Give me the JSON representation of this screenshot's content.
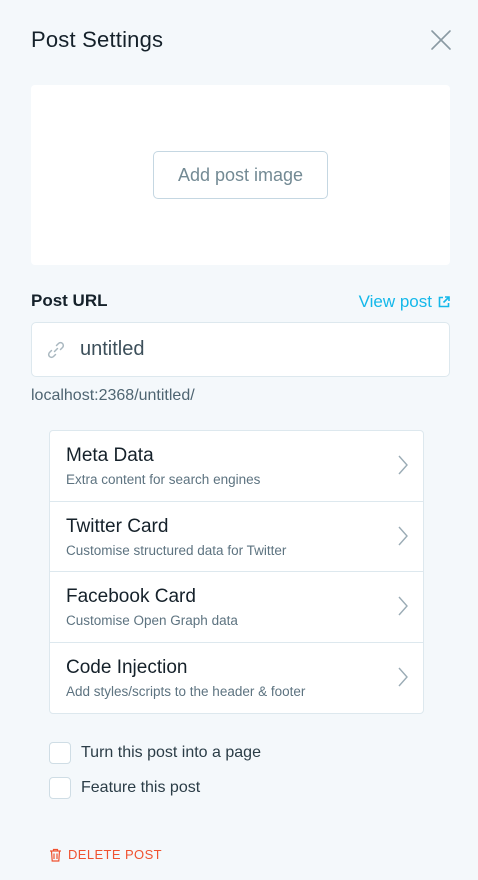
{
  "panel": {
    "title": "Post Settings"
  },
  "image": {
    "add_label": "Add post image"
  },
  "url": {
    "label": "Post URL",
    "view_post_label": "View post",
    "value": "untitled",
    "preview": "localhost:2368/untitled/"
  },
  "menu": {
    "items": [
      {
        "title": "Meta Data",
        "description": "Extra content for search engines"
      },
      {
        "title": "Twitter Card",
        "description": "Customise structured data for Twitter"
      },
      {
        "title": "Facebook Card",
        "description": "Customise Open Graph data"
      },
      {
        "title": "Code Injection",
        "description": "Add styles/scripts to the header & footer"
      }
    ]
  },
  "options": {
    "page_label": "Turn this post into a page",
    "feature_label": "Feature this post"
  },
  "danger": {
    "delete_label": "DELETE POST"
  },
  "colors": {
    "accent": "#14b8ea",
    "danger": "#f05230",
    "background": "#f4f8fb"
  },
  "icons": [
    "close-icon",
    "link-icon",
    "external-link-icon",
    "chevron-right-icon",
    "trash-icon"
  ]
}
